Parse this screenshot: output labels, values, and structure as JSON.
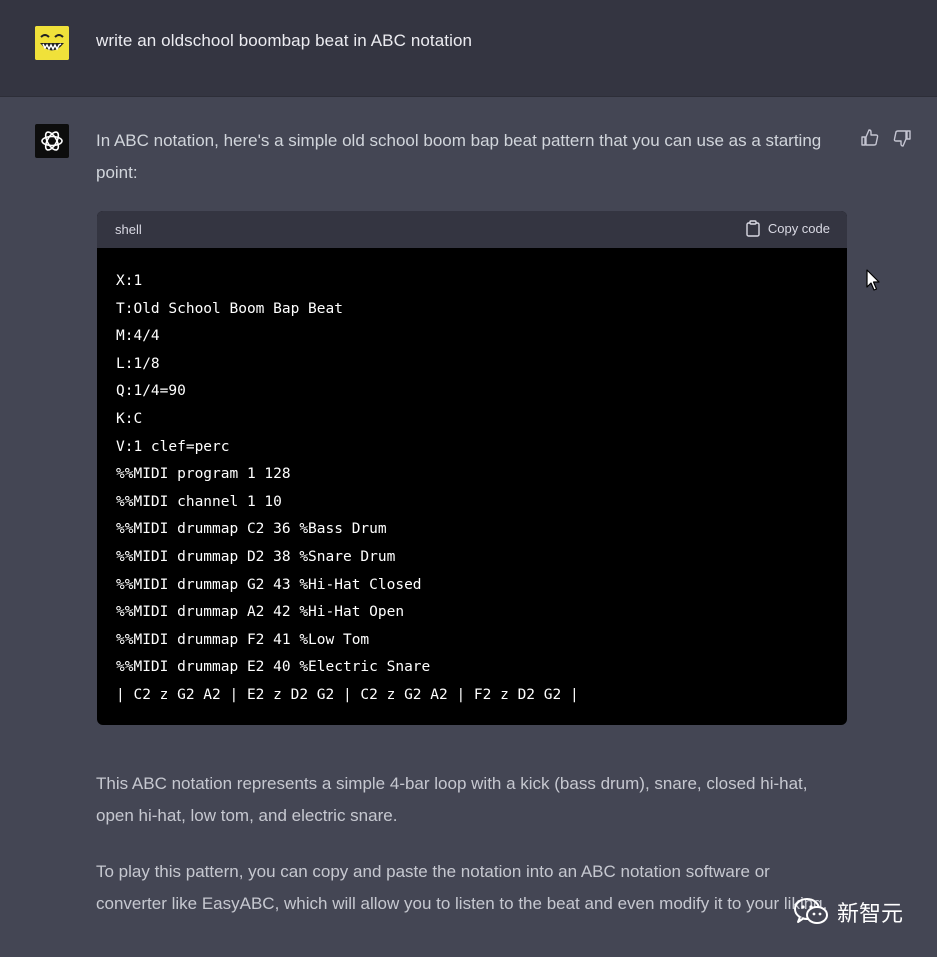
{
  "user_message": {
    "text": "write an oldschool boombap beat in ABC notation"
  },
  "assistant_message": {
    "intro": "In ABC notation, here's a simple old school boom bap beat pattern that you can use as a starting point:",
    "code_block": {
      "language": "shell",
      "copy_label": "Copy code",
      "lines": [
        "X:1",
        "T:Old School Boom Bap Beat",
        "M:4/4",
        "L:1/8",
        "Q:1/4=90",
        "K:C",
        "V:1 clef=perc",
        "%%MIDI program 1 128",
        "%%MIDI channel 1 10",
        "%%MIDI drummap C2 36 %Bass Drum",
        "%%MIDI drummap D2 38 %Snare Drum",
        "%%MIDI drummap G2 43 %Hi-Hat Closed",
        "%%MIDI drummap A2 42 %Hi-Hat Open",
        "%%MIDI drummap F2 41 %Low Tom",
        "%%MIDI drummap E2 40 %Electric Snare",
        "| C2 z G2 A2 | E2 z D2 G2 | C2 z G2 A2 | F2 z D2 G2 |"
      ]
    },
    "description": "This ABC notation represents a simple 4-bar loop with a kick (bass drum), snare, closed hi-hat, open hi-hat, low tom, and electric snare.",
    "play_instructions": "To play this pattern, you can copy and paste the notation into an ABC notation software or converter like EasyABC, which will allow you to listen to the beat and even modify it to your liking."
  },
  "watermark": {
    "text": "新智元"
  },
  "colors": {
    "user_background": "#343541",
    "assistant_background": "#444654",
    "code_background": "#000000",
    "code_header": "#343541",
    "user_avatar": "#f0e13a"
  },
  "icons": {
    "user_avatar": "smiley-face-icon",
    "bot_avatar": "openai-logo-icon",
    "feedback_up": "thumbs-up-icon",
    "feedback_down": "thumbs-down-icon",
    "copy": "clipboard-icon",
    "watermark": "wechat-icon"
  }
}
